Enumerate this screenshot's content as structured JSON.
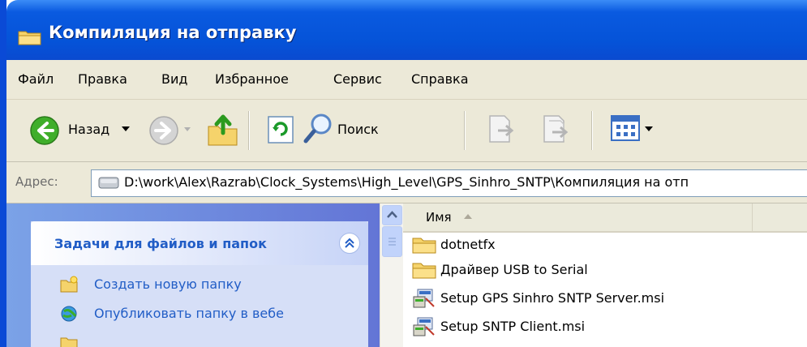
{
  "window": {
    "title": "Компиляция на отправку"
  },
  "menu": {
    "items": [
      "Файл",
      "Правка",
      "Вид",
      "Избранное",
      "Сервис",
      "Справка"
    ]
  },
  "toolbar": {
    "back_label": "Назад",
    "search_label": "Поиск"
  },
  "address": {
    "label": "Адрес:",
    "path": "D:\\work\\Alex\\Razrab\\Clock_Systems\\High_Level\\GPS_Sinhro_SNTP\\Компиляция на отп"
  },
  "tasks": {
    "header": "Задачи для файлов и папок",
    "items": [
      "Создать новую папку",
      "Опубликовать папку в вебе"
    ]
  },
  "filelist": {
    "column_name": "Имя",
    "files": [
      {
        "name": "dotnetfx",
        "icon": "folder-icon"
      },
      {
        "name": "Драйвер USB to Serial",
        "icon": "folder-icon"
      },
      {
        "name": "Setup GPS Sinhro SNTP Server.msi",
        "icon": "installer-icon"
      },
      {
        "name": "Setup SNTP Client.msi",
        "icon": "installer-icon"
      }
    ]
  },
  "colors": {
    "titlebar": "#0553d8",
    "chrome": "#ece9d8",
    "task_link": "#215dc6",
    "task_pane": "#6375d6"
  }
}
